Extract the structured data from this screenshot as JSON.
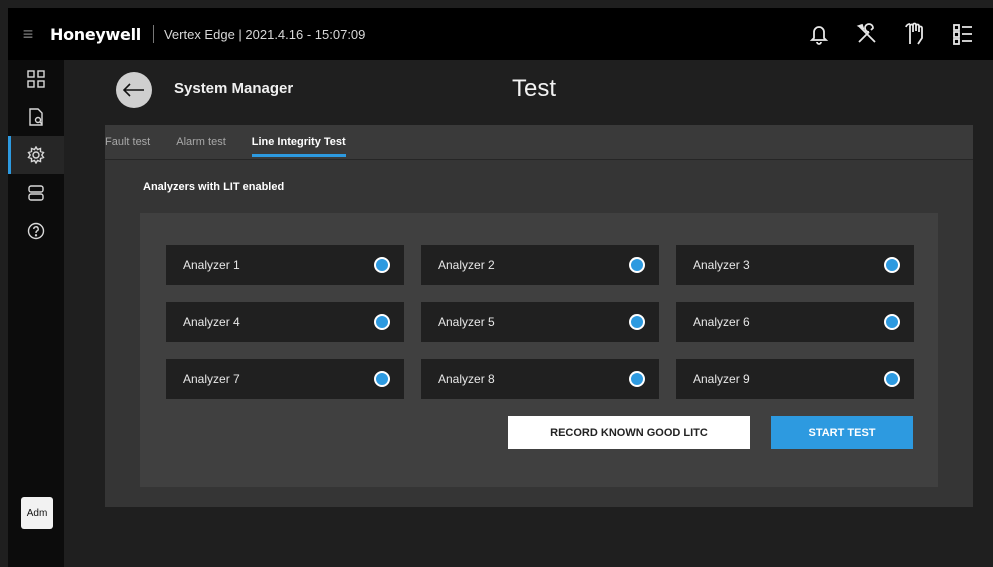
{
  "topbar": {
    "brand": "Honeywell",
    "subtitle": "Vertex Edge | 2021.4.16 - 15:07:09",
    "icons": [
      "bell-icon",
      "tools-icon",
      "hand-icon",
      "list-icon"
    ]
  },
  "sidebar": {
    "items": [
      "dashboard-icon",
      "document-icon",
      "settings-icon",
      "devices-icon",
      "help-icon"
    ],
    "active": "settings-icon",
    "user_badge": "Adm"
  },
  "header": {
    "section_title": "System Manager",
    "page_title": "Test"
  },
  "tabs": [
    {
      "label": "Fault test",
      "active": false
    },
    {
      "label": "Alarm test",
      "active": false
    },
    {
      "label": "Line Integrity Test",
      "active": true
    }
  ],
  "content": {
    "heading": "Analyzers with LIT enabled",
    "analyzers": [
      {
        "label": "Analyzer 1"
      },
      {
        "label": "Analyzer 2"
      },
      {
        "label": "Analyzer 3"
      },
      {
        "label": "Analyzer 4"
      },
      {
        "label": "Analyzer 5"
      },
      {
        "label": "Analyzer 6"
      },
      {
        "label": "Analyzer 7"
      },
      {
        "label": "Analyzer 8"
      },
      {
        "label": "Analyzer 9"
      }
    ],
    "record_button": "RECORD KNOWN GOOD LITC",
    "start_button": "START TEST"
  },
  "colors": {
    "accent": "#2d9ae0",
    "background": "#1f1f1f",
    "panel": "#353535"
  }
}
